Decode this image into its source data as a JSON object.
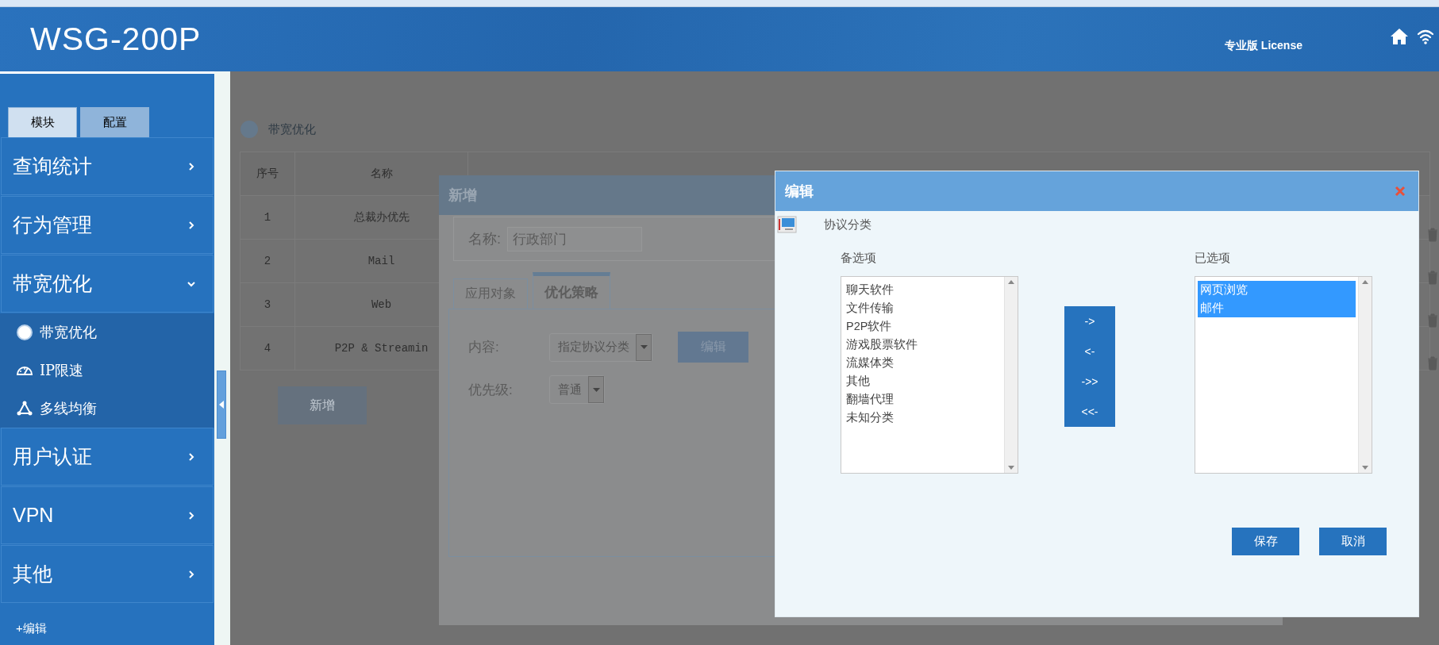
{
  "header": {
    "logo": "WSG-200P",
    "license": "专业版 License"
  },
  "sidebar": {
    "tabs": [
      {
        "label": "模块",
        "selected": false
      },
      {
        "label": "配置",
        "selected": true
      }
    ],
    "menu": [
      {
        "label": "查询统计",
        "expanded": false
      },
      {
        "label": "行为管理",
        "expanded": false
      },
      {
        "label": "带宽优化",
        "expanded": true,
        "children": [
          {
            "label": "带宽优化"
          },
          {
            "label": "IP限速"
          },
          {
            "label": "多线均衡"
          }
        ]
      },
      {
        "label": "用户认证",
        "expanded": false
      },
      {
        "label": "VPN",
        "expanded": false
      },
      {
        "label": "其他",
        "expanded": false
      }
    ],
    "edit_link": "+编辑"
  },
  "page": {
    "title": "带宽优化",
    "table": {
      "columns": [
        "序号",
        "名称"
      ],
      "rows": [
        [
          "1",
          "总裁办优先"
        ],
        [
          "2",
          "Mail"
        ],
        [
          "3",
          "Web"
        ],
        [
          "4",
          "P2P & Streamin"
        ]
      ]
    },
    "add_button": "新增"
  },
  "add_dialog": {
    "title": "新增",
    "name_label": "名称:",
    "name_value": "行政部门",
    "tabs": [
      {
        "label": "应用对象",
        "selected": false
      },
      {
        "label": "优化策略",
        "selected": true
      }
    ],
    "content_label": "内容:",
    "content_value": "指定协议分类",
    "edit_button": "编辑",
    "priority_label": "优先级:",
    "priority_value": "普通"
  },
  "edit_dialog": {
    "title": "编辑",
    "section": "协议分类",
    "available_label": "备选项",
    "available": [
      {
        "label": "聊天软件",
        "selected": false
      },
      {
        "label": "文件传输",
        "selected": false
      },
      {
        "label": "P2P软件",
        "selected": false
      },
      {
        "label": "游戏股票软件",
        "selected": false
      },
      {
        "label": "流媒体类",
        "selected": false
      },
      {
        "label": "其他",
        "selected": false
      },
      {
        "label": "翻墙代理",
        "selected": false
      },
      {
        "label": "未知分类",
        "selected": false
      }
    ],
    "chosen_label": "已选项",
    "chosen": [
      {
        "label": "网页浏览",
        "selected": true
      },
      {
        "label": "邮件",
        "selected": true
      }
    ],
    "move_buttons": [
      "->",
      "<-",
      "->>",
      "<<-"
    ],
    "buttons": [
      "保存",
      "取消"
    ]
  }
}
